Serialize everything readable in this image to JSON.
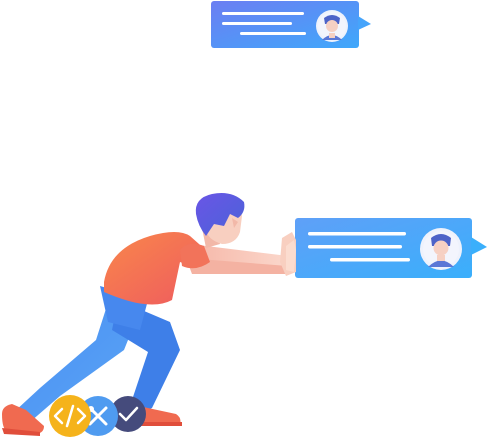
{
  "bubbles": [
    {
      "id": "top",
      "text_lines": 3,
      "avatar": "user-avatar-icon"
    },
    {
      "id": "pushed",
      "text_lines": 3,
      "avatar": "user-avatar-icon"
    }
  ],
  "badges": [
    {
      "icon": "code-icon",
      "color": "#F5B31B"
    },
    {
      "icon": "tools-icon",
      "color": "#4F9BF0"
    },
    {
      "icon": "check-icon",
      "color": "#454B7C"
    }
  ],
  "colors": {
    "bubble_gradient_start": "#6A86F5",
    "bubble_gradient_end": "#45A6FB",
    "shirt": "#F06A55",
    "pants": "#4C8CF0",
    "hair": "#5A4FD6",
    "skin": "#F8CFC0",
    "shoes": "#F26A50"
  }
}
